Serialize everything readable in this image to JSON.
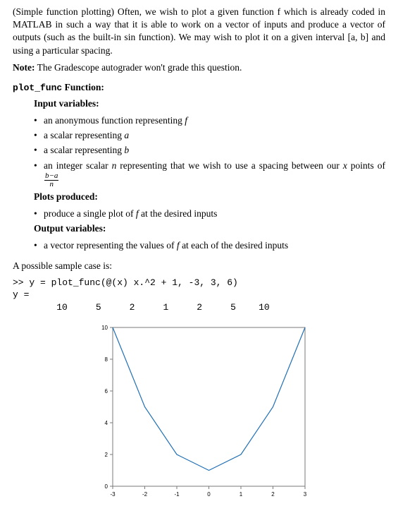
{
  "intro": "(Simple function plotting) Often, we wish to plot a given function f which is already coded in MATLAB in such a way that it is able to work on a vector of inputs and produce a vector of outputs (such as the built-in sin function). We may wish to plot it on a given interval [a, b] and using a particular spacing.",
  "note_label": "Note:",
  "note_text": " The Gradescope autograder won't grade this question.",
  "func_name": "plot_func",
  "func_heading_suffix": " Function:",
  "input_vars_heading": "Input variables:",
  "input_vars": [
    {
      "pre": "an anonymous function representing ",
      "sym": "f",
      "post": ""
    },
    {
      "pre": "a scalar representing ",
      "sym": "a",
      "post": ""
    },
    {
      "pre": "a scalar representing ",
      "sym": "b",
      "post": ""
    },
    {
      "pre": "an integer scalar ",
      "sym": "n",
      "post": " representing that we wish to use a spacing between our "
    }
  ],
  "frac_intro_sym": "x",
  "frac_mid": " points of ",
  "frac": {
    "num": "b−a",
    "den": "n"
  },
  "plots_heading": "Plots produced:",
  "plots_items": [
    {
      "pre": "produce a single plot of ",
      "sym": "f",
      "post": " at the desired inputs"
    }
  ],
  "output_heading": "Output variables:",
  "output_items": [
    {
      "pre": "a vector representing the values of ",
      "sym": "f",
      "post": " at each of the desired inputs"
    }
  ],
  "sample_case_line": "A possible sample case is:",
  "code_line": ">> y = plot_func(@(x) x.^2 + 1, -3, 3, 6)",
  "code_out1": "y =",
  "y_values": [
    "10",
    "5",
    "2",
    "1",
    "2",
    "5",
    "10"
  ],
  "chart_data": {
    "type": "line",
    "x": [
      -3,
      -2,
      -1,
      0,
      1,
      2,
      3
    ],
    "y": [
      10,
      5,
      2,
      1,
      2,
      5,
      10
    ],
    "xlim": [
      -3,
      3
    ],
    "ylim": [
      0,
      10
    ],
    "xticks": [
      -3,
      -2,
      -1,
      0,
      1,
      2,
      3
    ],
    "yticks": [
      0,
      2,
      4,
      6,
      8,
      10
    ],
    "title": "",
    "xlabel": "",
    "ylabel": ""
  }
}
